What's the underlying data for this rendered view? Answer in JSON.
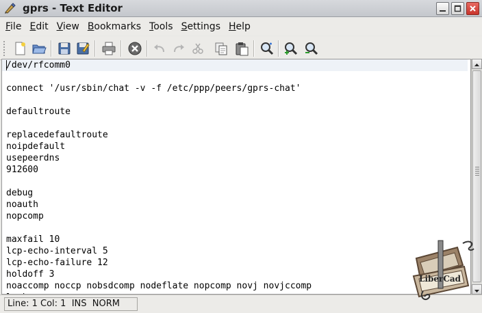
{
  "window": {
    "title": "gprs - Text Editor"
  },
  "menubar": {
    "items": [
      {
        "first": "F",
        "rest": "ile"
      },
      {
        "first": "E",
        "rest": "dit"
      },
      {
        "first": "V",
        "rest": "iew"
      },
      {
        "first": "B",
        "rest": "ookmarks"
      },
      {
        "first": "T",
        "rest": "ools"
      },
      {
        "first": "S",
        "rest": "ettings"
      },
      {
        "first": "H",
        "rest": "elp"
      }
    ]
  },
  "toolbar": {
    "icons": [
      "new-document-icon",
      "open-folder-icon",
      "save-icon",
      "save-as-icon",
      "print-icon",
      "stop-icon",
      "undo-icon",
      "redo-icon",
      "cut-icon",
      "copy-icon",
      "paste-icon",
      "find-icon",
      "zoom-in-icon",
      "zoom-out-icon"
    ]
  },
  "editor": {
    "lines": [
      "/dev/rfcomm0",
      "",
      "connect '/usr/sbin/chat -v -f /etc/ppp/peers/gprs-chat'",
      "",
      "defaultroute",
      "",
      "replacedefaultroute",
      "noipdefault",
      "usepeerdns",
      "912600",
      "",
      "debug",
      "noauth",
      "nopcomp",
      "",
      "maxfail 10",
      "lcp-echo-interval 5",
      "lcp-echo-failure 12",
      "holdoff 3",
      "noaccomp noccp nobsdcomp nodeflate nopcomp novj novjccomp",
      "lock"
    ]
  },
  "statusbar": {
    "text": "Line: 1 Col: 1  INS  NORM"
  },
  "watermark": {
    "text": "LiberCad"
  }
}
